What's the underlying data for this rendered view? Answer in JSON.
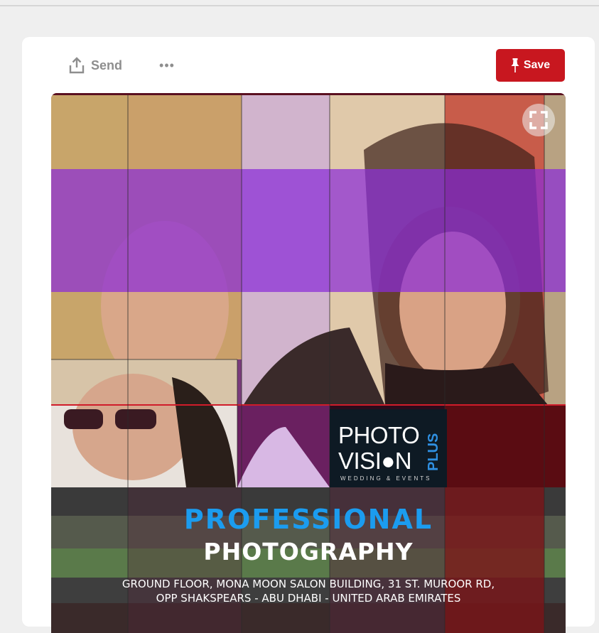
{
  "toolbar": {
    "send_label": "Send",
    "more_label": "•••",
    "save_label": "Save",
    "save_color": "#c8171f"
  },
  "pin": {
    "logo_line1": "PHOTO",
    "logo_line2": "VISI●N",
    "logo_plus": "PLUS",
    "logo_sub": "WEDDING & EVENTS",
    "headline1": "PROFESSIONAL",
    "headline2": "PHOTOGRAPHY",
    "address_line1": "GROUND FLOOR, MONA MOON SALON BUILDING, 31 ST. MUROOR RD,",
    "address_line2": "OPP SHAKSPEARS - ABU DHABI - UNITED ARAB EMIRATES",
    "headline1_color": "#1b9cef"
  },
  "icons": {
    "send": "share-upload-icon",
    "save": "pushpin-icon",
    "expand": "expand-corners-icon"
  }
}
